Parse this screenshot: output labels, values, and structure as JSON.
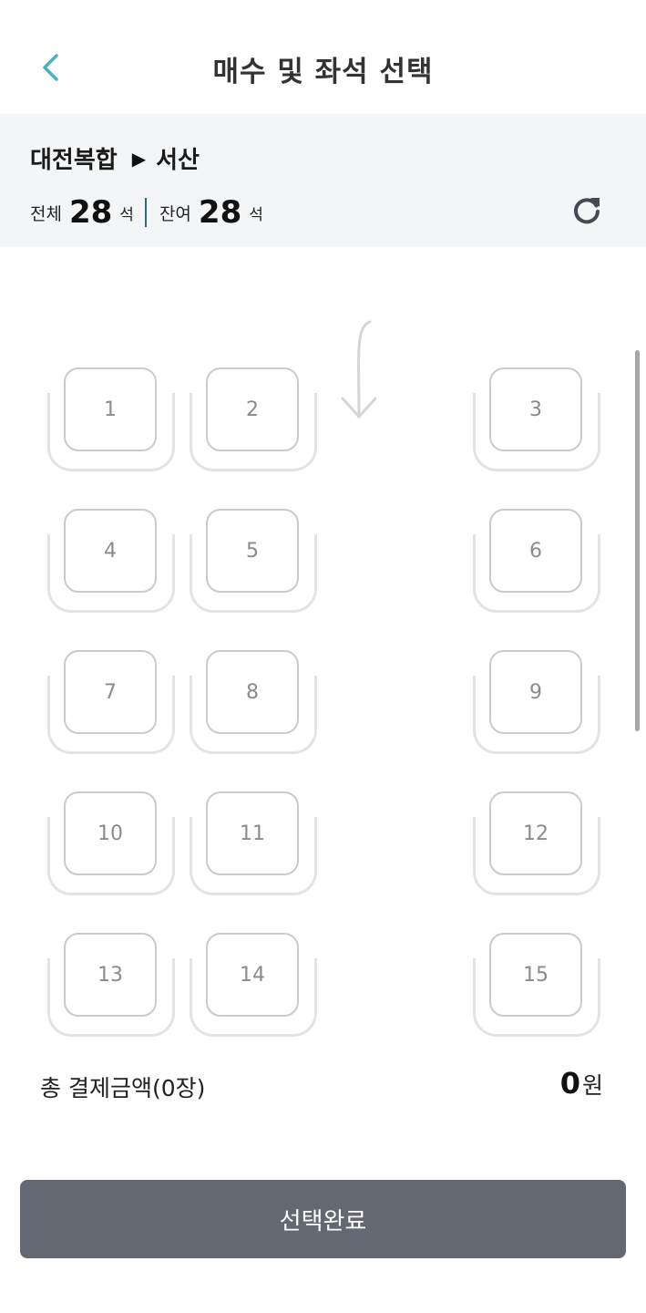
{
  "header": {
    "back_icon": "chevron-left-icon",
    "title": "매수 및 좌석 선택",
    "accent_color": "#4ab3c2"
  },
  "route": {
    "origin": "대전복합",
    "arrow": "▶",
    "destination": "서산"
  },
  "seat_summary": {
    "total_label": "전체",
    "total_count": "28",
    "total_unit": "석",
    "remaining_label": "잔여",
    "remaining_count": "28",
    "remaining_unit": "석",
    "refresh_icon": "refresh-icon"
  },
  "seats": [
    {
      "number": "1"
    },
    {
      "number": "2"
    },
    {
      "number": "3"
    },
    {
      "number": "4"
    },
    {
      "number": "5"
    },
    {
      "number": "6"
    },
    {
      "number": "7"
    },
    {
      "number": "8"
    },
    {
      "number": "9"
    },
    {
      "number": "10"
    },
    {
      "number": "11"
    },
    {
      "number": "12"
    },
    {
      "number": "13"
    },
    {
      "number": "14"
    },
    {
      "number": "15"
    }
  ],
  "payment": {
    "label": "총 결제금액(0장)",
    "amount": "0",
    "currency": "원"
  },
  "confirm_button": {
    "label": "선택완료",
    "color": "#646872"
  }
}
